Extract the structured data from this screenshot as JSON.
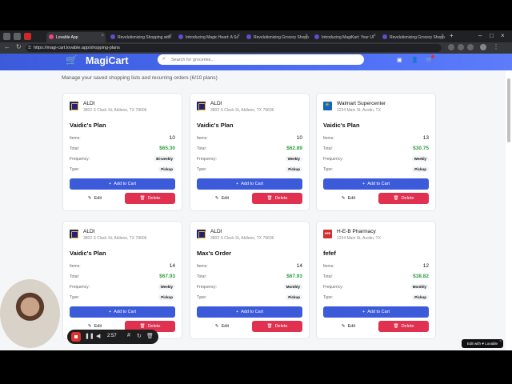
{
  "browser": {
    "tabs": [
      {
        "label": "Lovable App",
        "active": true
      },
      {
        "label": "Revolutionizing Shopping with"
      },
      {
        "label": "Introducing Magic Heart: A So"
      },
      {
        "label": "Revolutionizing Grocery Shopp"
      },
      {
        "label": "Introducing MagiKart: Your UI"
      },
      {
        "label": "Revolutionizing Grocery Shopp"
      }
    ],
    "url": "https://magi-cart.lovable.app/shopping-plans"
  },
  "header": {
    "logo": "MagiCart",
    "search_placeholder": "Search for groceries..."
  },
  "page": {
    "subtitle": "Manage your saved shopping lists and recurring orders (6/10 plans)"
  },
  "labels": {
    "items": "Items:",
    "total": "Total:",
    "frequency": "Frequency:",
    "type": "Type:",
    "add_to_cart": "Add to Cart",
    "edit": "Edit",
    "delete": "Delete"
  },
  "plans": [
    {
      "store": "ALDI",
      "address": "3802 S Clack St, Abilene, TX 79606",
      "name": "Vaidic's Plan",
      "items": "10",
      "total": "$65.30",
      "frequency": "Bi-weekly",
      "type": "Pickup"
    },
    {
      "store": "ALDI",
      "address": "3802 S Clack St, Abilene, TX 79606",
      "name": "Vaidic's Plan",
      "items": "10",
      "total": "$62.89",
      "frequency": "Weekly",
      "type": "Pickup"
    },
    {
      "store": "Walmart Supercenter",
      "address": "1234 Main St, Austin, TX",
      "name": "Vaidic's Plan",
      "items": "13",
      "total": "$30.75",
      "frequency": "Weekly",
      "type": "Pickup"
    },
    {
      "store": "ALDI",
      "address": "3802 S Clack St, Abilene, TX 79606",
      "name": "Vaidic's Plan",
      "items": "14",
      "total": "$67.93",
      "frequency": "Weekly",
      "type": "Pickup"
    },
    {
      "store": "ALDI",
      "address": "3802 S Clack St, Abilene, TX 79606",
      "name": "Max's Order",
      "items": "14",
      "total": "$67.93",
      "frequency": "Monthly",
      "type": "Pickup"
    },
    {
      "store": "H-E-B Pharmacy",
      "address": "1234 Main St, Austin, TX",
      "name": "fefef",
      "items": "12",
      "total": "$38.82",
      "frequency": "Monthly",
      "type": "Pickup"
    }
  ],
  "recorder": {
    "time": "2:57"
  },
  "lovable_badge": "Edit with ♥ Lovable",
  "colors": {
    "header_blue": "#4c6ef5",
    "button_blue": "#3b5bdb",
    "delete_red": "#e03150",
    "total_green": "#2f9e44"
  }
}
